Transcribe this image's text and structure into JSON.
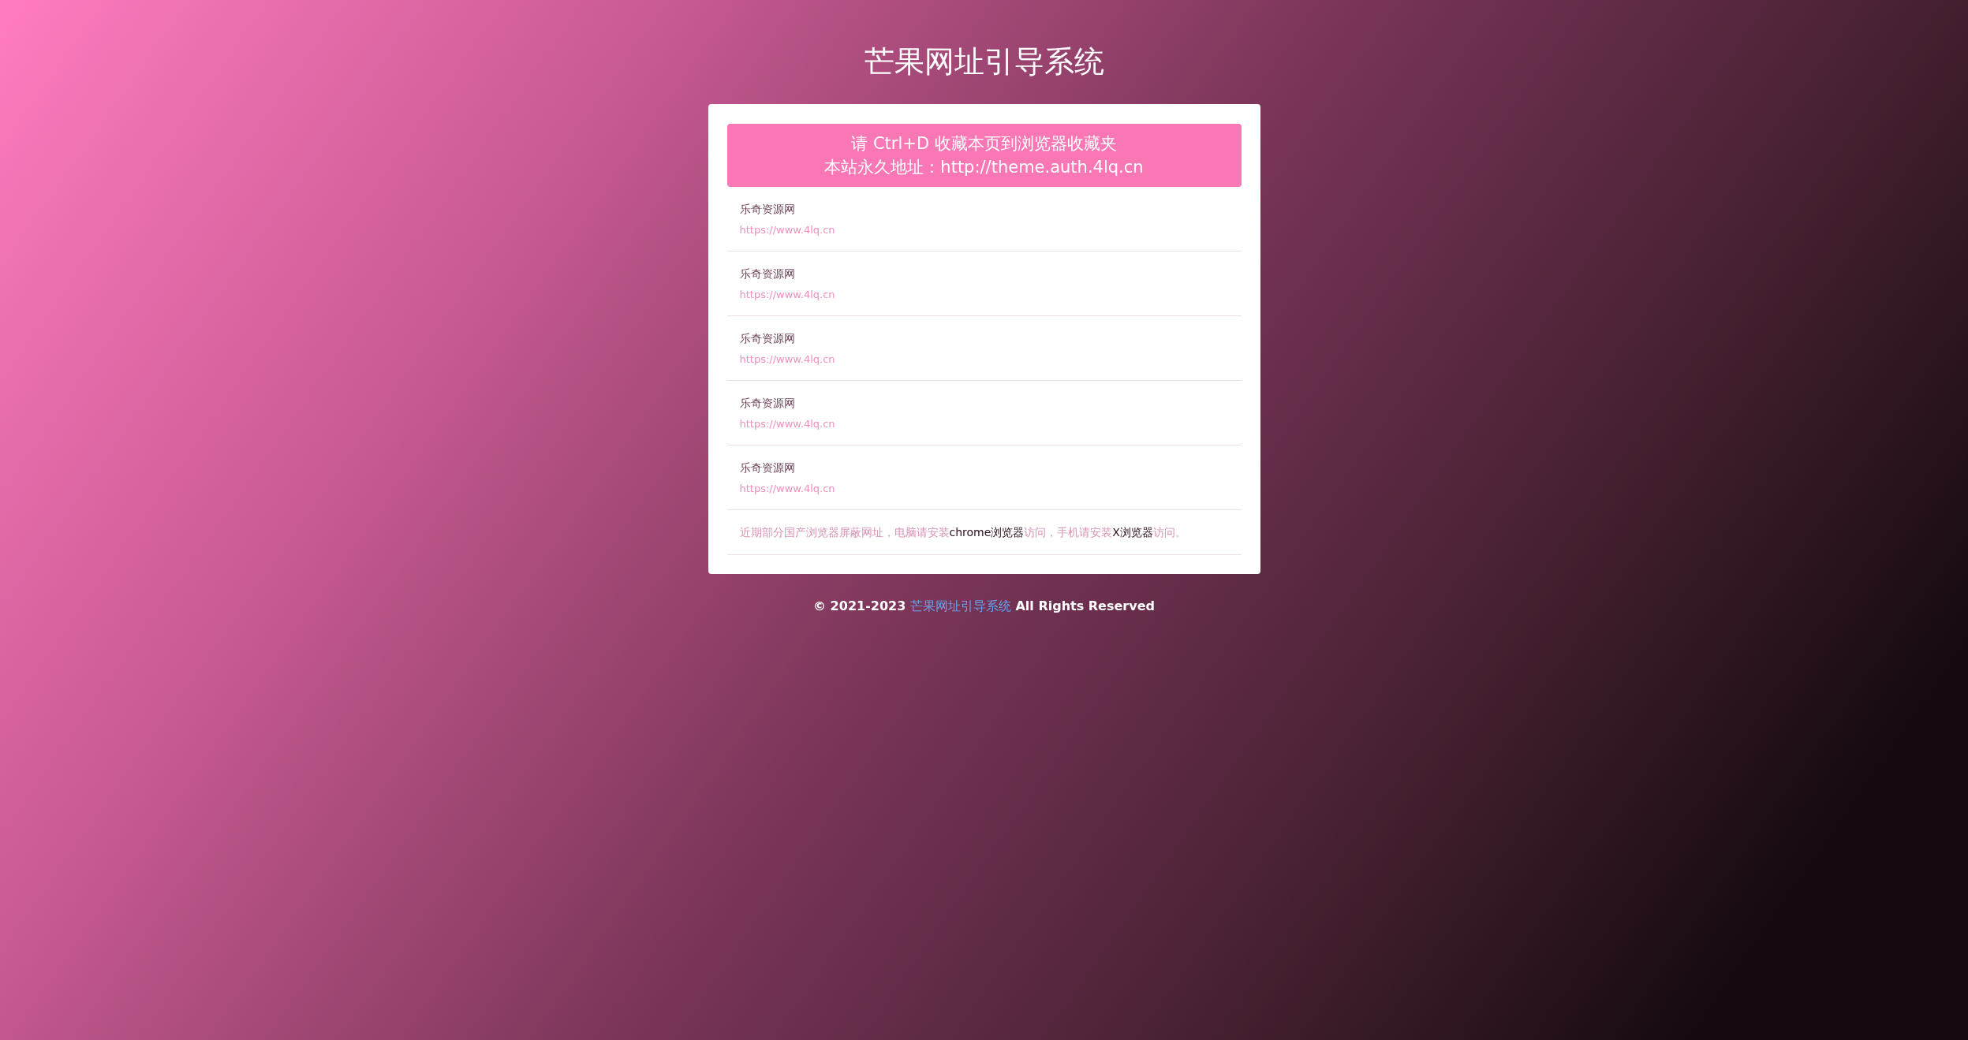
{
  "title": "芒果网址引导系统",
  "banner": {
    "lines": [
      "请 Ctrl+D 收藏本页到浏览器收藏夹",
      "本站永久地址：http://theme.auth.4lq.cn"
    ]
  },
  "links": [
    {
      "name": "乐奇资源网",
      "url": "https://www.4lq.cn"
    },
    {
      "name": "乐奇资源网",
      "url": "https://www.4lq.cn"
    },
    {
      "name": "乐奇资源网",
      "url": "https://www.4lq.cn"
    },
    {
      "name": "乐奇资源网",
      "url": "https://www.4lq.cn"
    },
    {
      "name": "乐奇资源网",
      "url": "https://www.4lq.cn"
    }
  ],
  "notice": [
    {
      "kind": "text",
      "text": "近期部分国产浏览器屏蔽网址，电脑请安装"
    },
    {
      "kind": "link",
      "text": "chrome浏览器"
    },
    {
      "kind": "text",
      "text": "访问，手机请安装"
    },
    {
      "kind": "link",
      "text": "X浏览器"
    },
    {
      "kind": "text",
      "text": "访问。"
    }
  ],
  "footer": [
    {
      "kind": "text",
      "text": "© 2021-2023 "
    },
    {
      "kind": "link",
      "text": "芒果网址引导系统"
    },
    {
      "kind": "text",
      "text": " All Rights Reserved"
    }
  ]
}
